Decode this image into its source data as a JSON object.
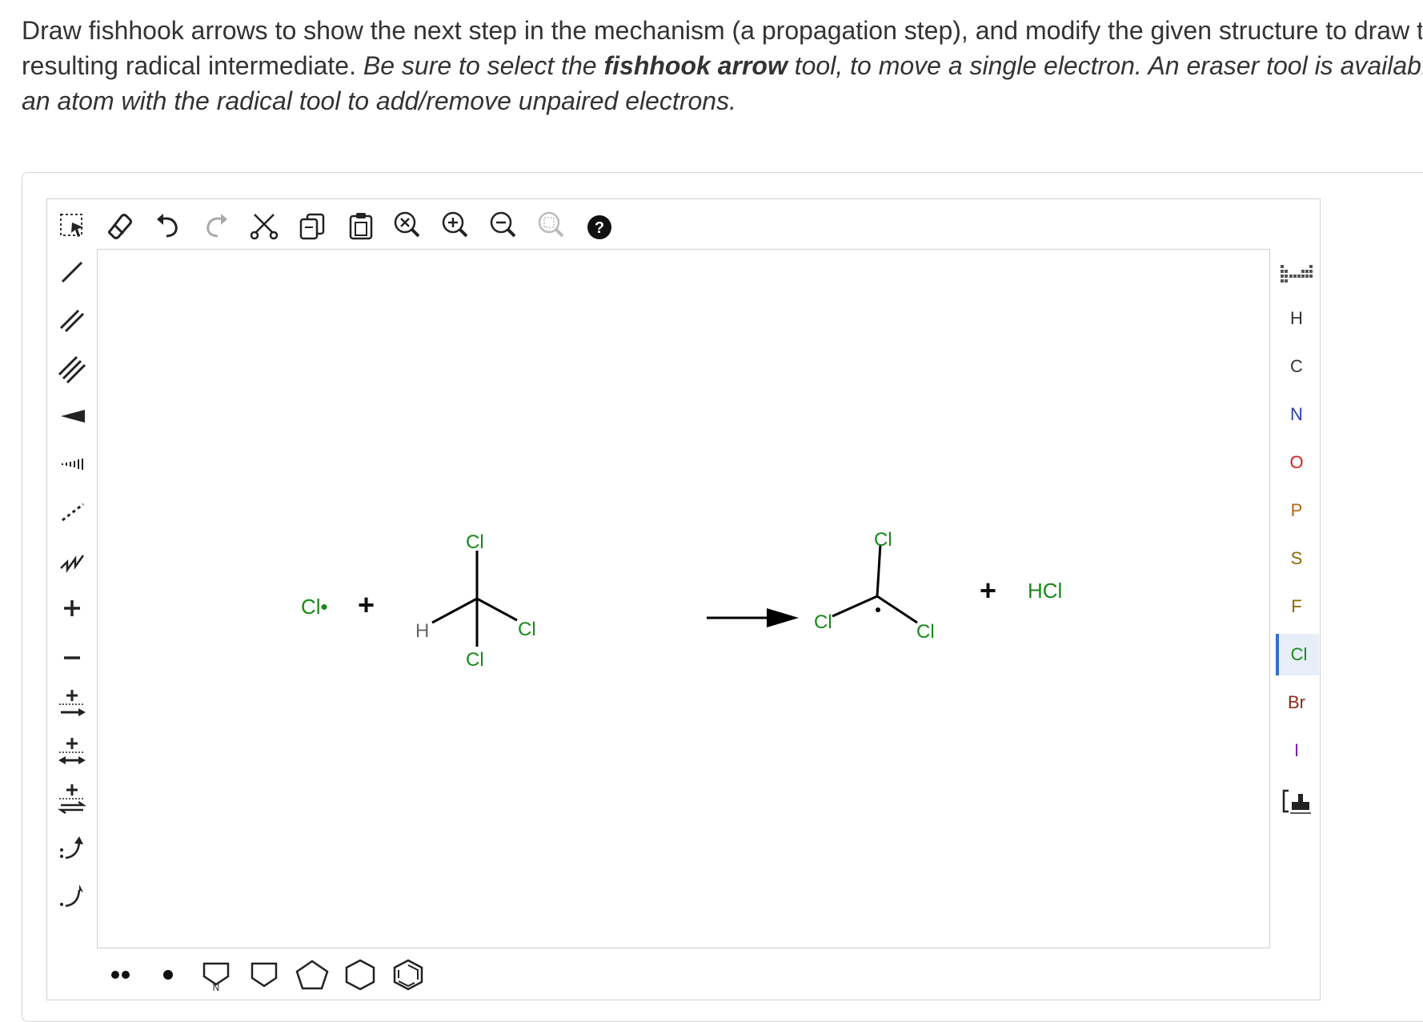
{
  "prompt": {
    "line1": "Draw fishhook arrows to show the next step in the mechanism (a propagation step), and modify the given structure to draw the",
    "line2_plain": "resulting radical intermediate. ",
    "line2_italic_a": "Be sure to select the ",
    "line2_bold": "fishhook arrow",
    "line2_italic_b": " tool, to move a single electron. An eraser tool is available, and click on",
    "line3_italic": "an atom with the radical tool to add/remove unpaired electrons."
  },
  "top_toolbar": [
    {
      "name": "select-tool",
      "icon": "lasso-select-icon"
    },
    {
      "name": "erase-tool",
      "icon": "eraser-icon"
    },
    {
      "name": "undo-button",
      "icon": "undo-icon"
    },
    {
      "name": "redo-button",
      "icon": "redo-icon"
    },
    {
      "name": "cut-button",
      "icon": "scissors-icon"
    },
    {
      "name": "copy-button",
      "icon": "copy-icon"
    },
    {
      "name": "paste-button",
      "icon": "paste-icon"
    },
    {
      "name": "clear-zoom-button",
      "icon": "zoom-clear-icon"
    },
    {
      "name": "zoom-in-button",
      "icon": "zoom-in-icon"
    },
    {
      "name": "zoom-out-button",
      "icon": "zoom-out-icon"
    },
    {
      "name": "zoom-fit-button",
      "icon": "zoom-fit-icon"
    },
    {
      "name": "help-button",
      "icon": "help-icon"
    }
  ],
  "left_toolbar": [
    {
      "name": "single-bond-tool",
      "icon": "single-bond-icon"
    },
    {
      "name": "double-bond-tool",
      "icon": "double-bond-icon"
    },
    {
      "name": "triple-bond-tool",
      "icon": "triple-bond-icon"
    },
    {
      "name": "wedge-bond-tool",
      "icon": "wedge-bond-icon"
    },
    {
      "name": "hashed-bond-tool",
      "icon": "hashed-bond-icon"
    },
    {
      "name": "dashed-bond-tool",
      "icon": "dashed-bond-icon"
    },
    {
      "name": "chain-tool",
      "icon": "chain-icon"
    },
    {
      "name": "positive-charge-tool",
      "icon": "plus-icon"
    },
    {
      "name": "negative-charge-tool",
      "icon": "minus-icon"
    },
    {
      "name": "reaction-arrow-tool",
      "icon": "reaction-arrow-icon"
    },
    {
      "name": "resonance-arrow-tool",
      "icon": "resonance-arrow-icon"
    },
    {
      "name": "equilibrium-arrow-tool",
      "icon": "equilibrium-arrow-icon"
    },
    {
      "name": "curved-arrow-tool",
      "icon": "curved-arrow-icon"
    },
    {
      "name": "fishhook-arrow-tool",
      "icon": "fishhook-arrow-icon"
    }
  ],
  "elements": {
    "periodic": "periodic-table-icon",
    "list": [
      {
        "symbol": "H",
        "color": "#333333"
      },
      {
        "symbol": "C",
        "color": "#333333"
      },
      {
        "symbol": "N",
        "color": "#2a3fb0"
      },
      {
        "symbol": "O",
        "color": "#d62020"
      },
      {
        "symbol": "P",
        "color": "#b5650d"
      },
      {
        "symbol": "S",
        "color": "#8a6a00"
      },
      {
        "symbol": "F",
        "color": "#8a6a00"
      },
      {
        "symbol": "Cl",
        "color": "#178a17",
        "selected": true
      },
      {
        "symbol": "Br",
        "color": "#8b2a1a"
      },
      {
        "symbol": "I",
        "color": "#7a1fa0"
      }
    ],
    "template": "template-bracket-icon"
  },
  "bottom_toolbar": [
    {
      "name": "lone-pair-tool",
      "icon": "lone-pair-icon"
    },
    {
      "name": "radical-tool",
      "icon": "radical-icon"
    },
    {
      "name": "ring-template-tool",
      "icon": "pyrrolidine-ring-icon",
      "label": "N"
    },
    {
      "name": "cyclobutane-tool",
      "icon": "cyclobutane-icon"
    },
    {
      "name": "cyclopentane-tool",
      "icon": "cyclopentane-icon"
    },
    {
      "name": "cyclohexane-tool",
      "icon": "cyclohexane-icon"
    },
    {
      "name": "benzene-tool",
      "icon": "benzene-icon"
    }
  ],
  "reaction": {
    "reagent": "Cl•",
    "plus1": "+",
    "reactant_atoms": {
      "top": "Cl",
      "left": "H",
      "right": "Cl",
      "bottom": "Cl"
    },
    "product_atoms": {
      "top": "Cl",
      "left": "Cl",
      "right": "Cl"
    },
    "plus2": "+",
    "byproduct": "HCl",
    "colors": {
      "chlorine": "#178a17",
      "hydrogen": "#666666",
      "bond": "#000000"
    }
  }
}
